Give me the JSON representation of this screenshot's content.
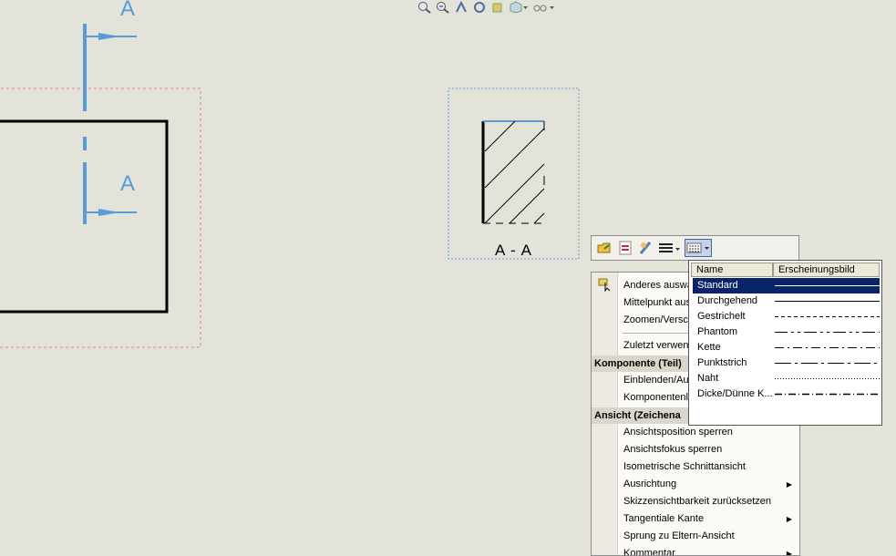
{
  "section_labels": {
    "top": "A",
    "bottom": "A"
  },
  "view_caption": "A - A",
  "top_toolbar_icons": [
    "zoom-in-icon",
    "zoom-area-icon",
    "pan-icon",
    "rotate-icon",
    "view-orient-icon",
    "display-style-icon",
    "hide-show-icon"
  ],
  "mini_toolbar_icons": [
    "open-folder-icon",
    "swap-icon",
    "edit-properties-icon",
    "line-weight-icon",
    "line-style-icon"
  ],
  "context_menu": {
    "items_top": [
      "Anderes auswä",
      "Mittelpunkt aus",
      "Zoomen/Versch",
      "Zuletzt verwen"
    ],
    "section1": "Komponente (Teil)",
    "items_mid": [
      "Einblenden/Aus",
      "Komponentenli"
    ],
    "section2": "Ansicht (Zeichena",
    "items_bottom": [
      {
        "label": "Ansichtsposition sperren",
        "submenu": false
      },
      {
        "label": "Ansichtsfokus sperren",
        "submenu": false
      },
      {
        "label": "Isometrische Schnittansicht",
        "submenu": false
      },
      {
        "label": "Ausrichtung",
        "submenu": true
      },
      {
        "label": "Skizzensichtbarkeit zurücksetzen",
        "submenu": false
      },
      {
        "label": "Tangentiale Kante",
        "submenu": true
      },
      {
        "label": "Sprung zu Eltern-Ansicht",
        "submenu": false
      },
      {
        "label": "Kommentar",
        "submenu": true
      }
    ]
  },
  "line_style_dropdown": {
    "col_name": "Name",
    "col_appearance": "Erscheinungsbild",
    "selected": "Standard",
    "items": [
      "Standard",
      "Durchgehend",
      "Gestrichelt",
      "Phantom",
      "Kette",
      "Punktstrich",
      "Naht",
      "Dicke/Dünne K..."
    ]
  },
  "colors": {
    "canvas": "#e4e3da",
    "section_line": "#5b9bd5",
    "selection": "#0a246a",
    "boundary": "#e57b9a"
  }
}
